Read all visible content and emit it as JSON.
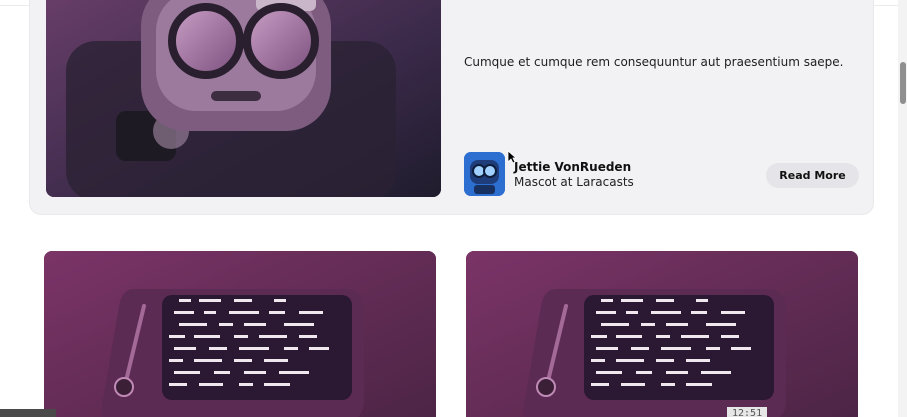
{
  "featured_post": {
    "excerpt": "Cumque et cumque rem consequuntur aut praesentium saepe.",
    "author": {
      "name": "Jettie VonRueden",
      "role": "Mascot at Laracasts"
    },
    "read_more_label": "Read More"
  },
  "video_overlay": {
    "timestamp": "12:51"
  },
  "colors": {
    "card_background": "#f2f2f4",
    "button_background": "#e5e5e9",
    "avatar_blue": "#2d6fd1",
    "thumbnail_magenta": "#6b2d5c"
  },
  "icons": {
    "cursor": "mouse-pointer-icon"
  }
}
